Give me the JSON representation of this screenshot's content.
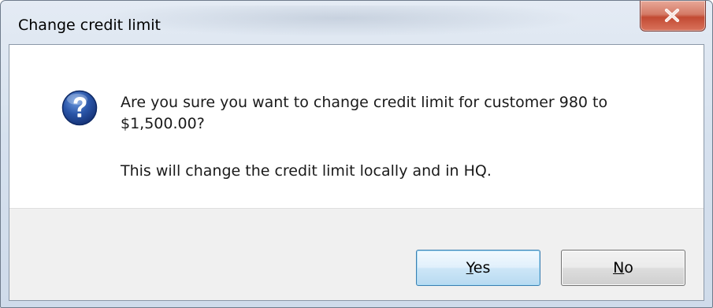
{
  "window": {
    "title": "Change credit limit",
    "close_icon": "close-icon"
  },
  "message": {
    "icon": "question-icon",
    "line1": "Are you sure you want to change credit limit for customer 980 to",
    "line2": "$1,500.00?",
    "detail": "This will change the credit limit locally and in HQ."
  },
  "buttons": {
    "yes": {
      "mnemonic": "Y",
      "rest": "es"
    },
    "no": {
      "mnemonic": "N",
      "rest": "o"
    }
  },
  "colors": {
    "close_button": "#c24a33",
    "default_button_border": "#3c7fb1",
    "question_icon": "#2a55a8"
  }
}
